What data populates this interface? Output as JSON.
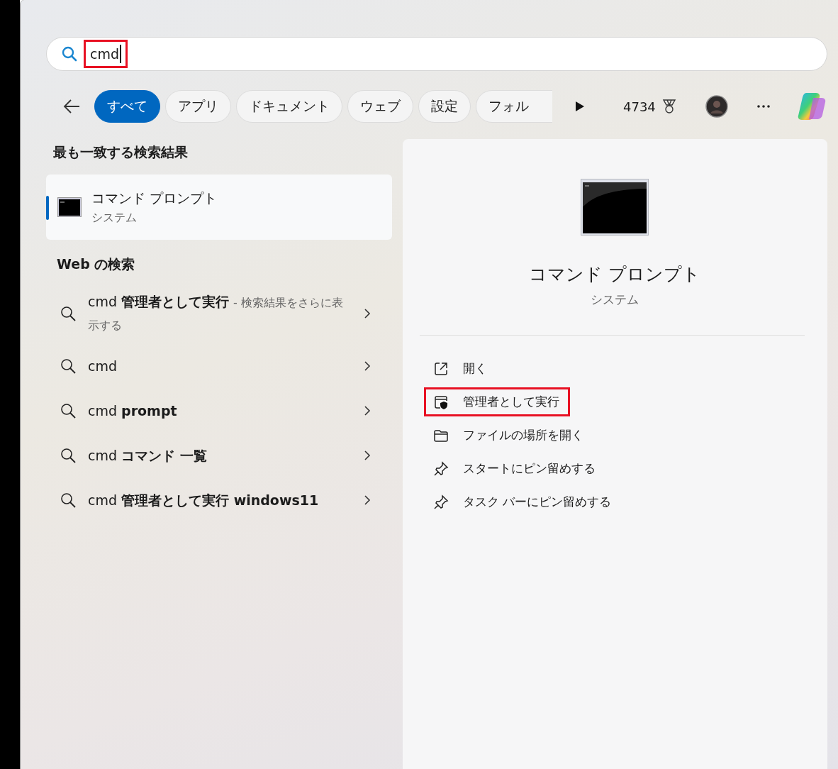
{
  "search": {
    "value": "cmd",
    "highlighted": true
  },
  "filters": [
    {
      "label": "すべて",
      "selected": true
    },
    {
      "label": "アプリ",
      "selected": false
    },
    {
      "label": "ドキュメント",
      "selected": false
    },
    {
      "label": "ウェブ",
      "selected": false
    },
    {
      "label": "設定",
      "selected": false
    },
    {
      "label": "フォル",
      "selected": false,
      "cut": true
    }
  ],
  "points": "4734",
  "best_match": {
    "heading": "最も一致する検索結果",
    "title": "コマンド プロンプト",
    "subtitle": "システム",
    "selected": true
  },
  "web": {
    "heading": "Web の検索",
    "items": [
      {
        "query": "cmd **管理者として実行**",
        "note": "- 検索結果をさらに表示する"
      },
      {
        "query": "cmd"
      },
      {
        "query": "cmd **prompt**"
      },
      {
        "query": "cmd **コマンド 一覧**"
      },
      {
        "query": "cmd **管理者として実行 windows11**"
      }
    ]
  },
  "detail": {
    "title": "コマンド プロンプト",
    "subtitle": "システム",
    "actions": [
      {
        "kind": "open",
        "label": "開く",
        "highlighted": false
      },
      {
        "kind": "admin",
        "label": "管理者として実行",
        "highlighted": true
      },
      {
        "kind": "folder",
        "label": "ファイルの場所を開く",
        "highlighted": false
      },
      {
        "kind": "pin",
        "label": "スタートにピン留めする",
        "highlighted": false
      },
      {
        "kind": "pin",
        "label": "タスク バーにピン留めする",
        "highlighted": false
      }
    ]
  }
}
